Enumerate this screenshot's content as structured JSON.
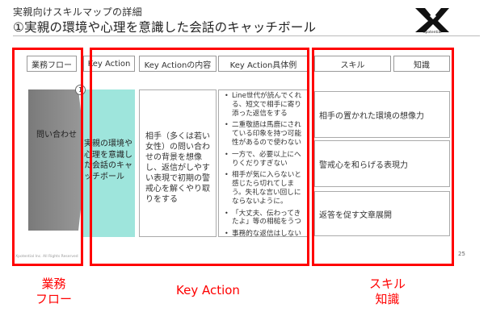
{
  "header": {
    "title_line1": "実親向けスキルマップの詳細",
    "title_line2": "①実親の環境や心理を意識した会話のキャッチボール",
    "logo_text": "Xpotential"
  },
  "columns": {
    "business_flow": "業務フロー",
    "key_action": "Key Action",
    "key_action_content": "Key Actionの内容",
    "key_action_examples": "Key Action具体例",
    "skill": "スキル",
    "knowledge": "知識"
  },
  "flow": {
    "label": "問い合わせ"
  },
  "key_action": {
    "number": "1",
    "text": "実親の環境や心理を意識した会話のキャッチボール"
  },
  "content": {
    "text": "相手（多くは若い女性）の問い合わせの背景を想像し、返信がしやすい表現で初期の警戒心を解くやり取りをする"
  },
  "examples": [
    "Line世代が読んでくれる、短文で相手に寄り添った返信をする",
    "二重敬語は馬鹿にされている印象を持つ可能性があるので使わない",
    "一方で、必要以上にへりくだりすぎない",
    "相手が気に入らないと感じたら切れてしまう。失礼な言い回しにならないように。",
    "「大丈夫、伝わってきたよ」等の相槌をうつ",
    "事務的な返信はしない"
  ],
  "skills": [
    "相手の置かれた環境の想像力",
    "警戒心を和らげる表現力",
    "返答を促す文章展開"
  ],
  "footer": {
    "copyright": "Xpotential Inc. All Rights Reserved",
    "page_number": "25"
  },
  "annotations": {
    "business_flow_label": "業務\nフロー",
    "key_action_label": "Key Action",
    "skill_knowledge_label": "スキル\n知識"
  },
  "colors": {
    "teal": "#9ee5dc",
    "annotation_red": "#ff0000",
    "chevron_gray": "#888888"
  }
}
